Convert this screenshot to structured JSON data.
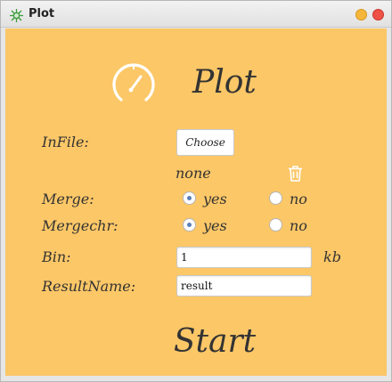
{
  "window": {
    "title": "Plot",
    "app_icon": "plot-app-icon",
    "colors": {
      "titlebar": "#e6e6e6",
      "minimize": "#f5b73b",
      "close": "#ee5145"
    }
  },
  "header": {
    "icon": "gauge-icon",
    "title": "Plot"
  },
  "colors": {
    "background": "#fcc767",
    "text": "#333333"
  },
  "form": {
    "infile": {
      "label": "InFile:",
      "button_label": "Choose",
      "status": "none",
      "delete_icon": "trash-icon"
    },
    "merge": {
      "label": "Merge:",
      "options": [
        "yes",
        "no"
      ],
      "selected": "yes"
    },
    "mergechr": {
      "label": "Mergechr:",
      "options": [
        "yes",
        "no"
      ],
      "selected": "yes"
    },
    "bin": {
      "label": "Bin:",
      "value": "1",
      "unit": "kb"
    },
    "result_name": {
      "label": "ResultName:",
      "value": "result"
    }
  },
  "start_label": "Start"
}
